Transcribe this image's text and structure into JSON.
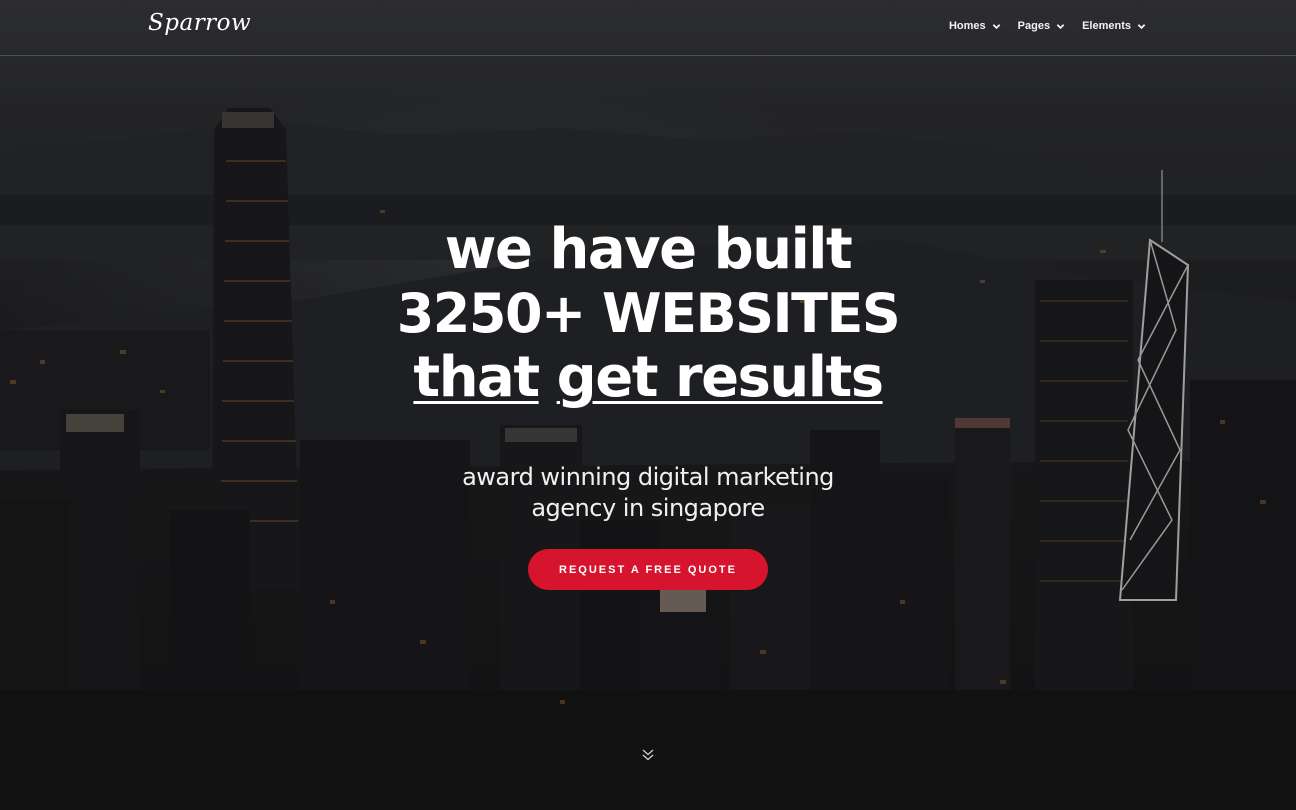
{
  "header": {
    "logo": "Sparrow",
    "nav": [
      {
        "label": "Homes",
        "icon": "chevron-down-icon"
      },
      {
        "label": "Pages",
        "icon": "chevron-down-icon"
      },
      {
        "label": "Elements",
        "icon": "chevron-down-icon"
      }
    ]
  },
  "hero": {
    "line1": "we have built",
    "line2": "3250+ WEBSITES",
    "line3_a": "that",
    "line3_b": "get results",
    "subtitle_line1": "award winning digital marketing",
    "subtitle_line2": "agency in singapore",
    "cta_label": "REQUEST A FREE QUOTE",
    "scroll_icon": "double-chevron-down-icon",
    "background": "night city skyline photo"
  },
  "colors": {
    "accent": "#d6142e",
    "text": "#ffffff"
  }
}
